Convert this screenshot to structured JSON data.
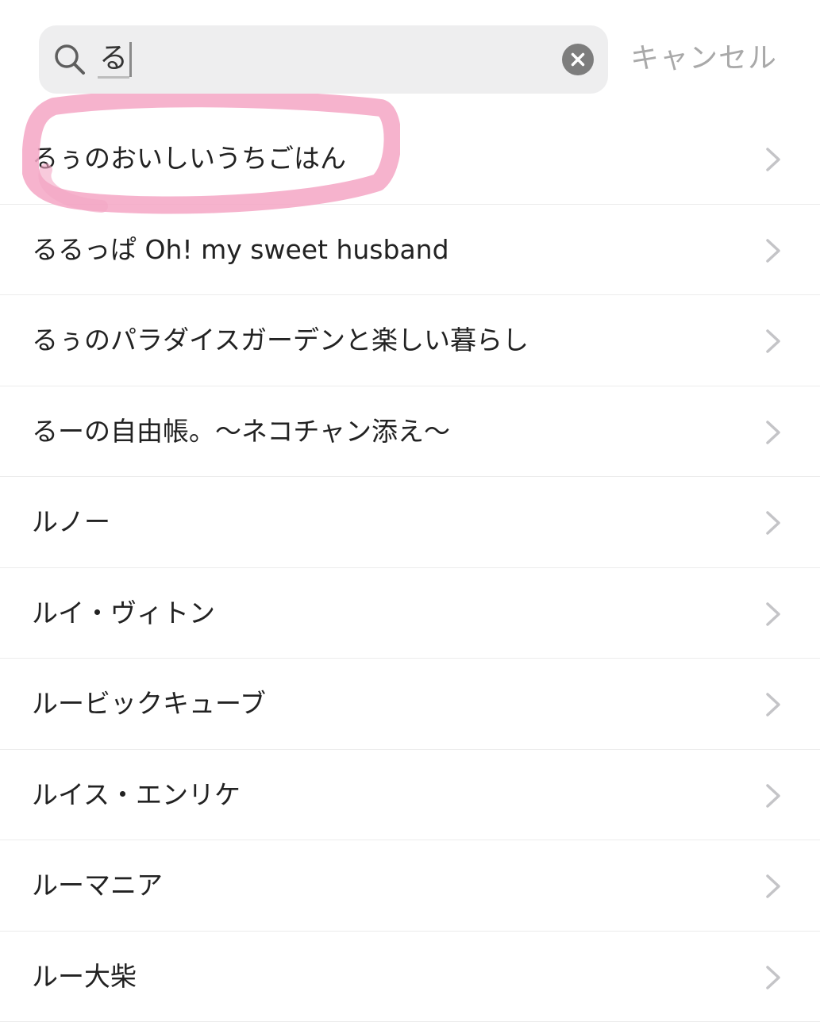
{
  "search": {
    "query": "る",
    "cancel_label": "キャンセル"
  },
  "results": [
    {
      "label": "るぅのおいしいうちごはん"
    },
    {
      "label": "るるっぱ Oh! my sweet husband"
    },
    {
      "label": "るぅのパラダイスガーデンと楽しい暮らし"
    },
    {
      "label": "るーの自由帳。〜ネコチャン添え〜"
    },
    {
      "label": "ルノー"
    },
    {
      "label": "ルイ・ヴィトン"
    },
    {
      "label": "ルービックキューブ"
    },
    {
      "label": "ルイス・エンリケ"
    },
    {
      "label": "ルーマニア"
    },
    {
      "label": "ルー大柴"
    }
  ],
  "icons": {
    "search": "search-icon",
    "clear": "clear-icon",
    "chevron": "chevron-right-icon"
  },
  "colors": {
    "highlight": "#f4a6c4",
    "field_background": "#eeeeef",
    "cancel_text": "#a9a9a9"
  }
}
